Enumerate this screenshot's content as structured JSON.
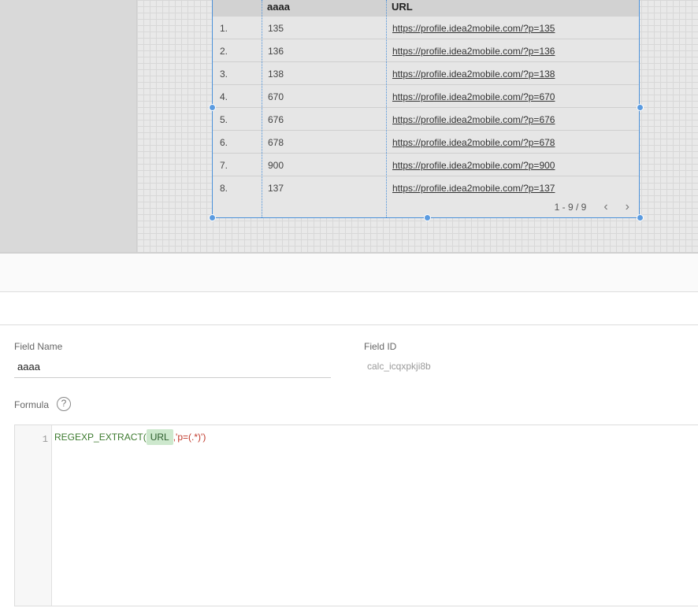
{
  "table": {
    "headers": {
      "dimension": "aaaa",
      "url": "URL"
    },
    "rows": [
      {
        "index": "1.",
        "value": "135",
        "url": "https://profile.idea2mobile.com/?p=135"
      },
      {
        "index": "2.",
        "value": "136",
        "url": "https://profile.idea2mobile.com/?p=136"
      },
      {
        "index": "3.",
        "value": "138",
        "url": "https://profile.idea2mobile.com/?p=138"
      },
      {
        "index": "4.",
        "value": "670",
        "url": "https://profile.idea2mobile.com/?p=670"
      },
      {
        "index": "5.",
        "value": "676",
        "url": "https://profile.idea2mobile.com/?p=676"
      },
      {
        "index": "6.",
        "value": "678",
        "url": "https://profile.idea2mobile.com/?p=678"
      },
      {
        "index": "7.",
        "value": "900",
        "url": "https://profile.idea2mobile.com/?p=900"
      },
      {
        "index": "8.",
        "value": "137",
        "url": "https://profile.idea2mobile.com/?p=137"
      }
    ],
    "pagination": {
      "label": "1 - 9 / 9",
      "prev_icon": "chevron-left-icon",
      "next_icon": "chevron-right-icon"
    }
  },
  "editor": {
    "field_name_label": "Field Name",
    "field_name_value": "aaaa",
    "field_id_label": "Field ID",
    "field_id_value": "calc_icqxpkji8b",
    "formula_label": "Formula",
    "help_icon": "?",
    "line_number": "1",
    "formula": {
      "function": "REGEXP_EXTRACT(",
      "field_chip": "URL",
      "argument": ",'p=(.*)')"
    }
  },
  "colors": {
    "selection": "#4a90d9",
    "function_text": "#3c7a2e",
    "chip_bg": "#cde8cd",
    "string_text": "#c0392b"
  }
}
